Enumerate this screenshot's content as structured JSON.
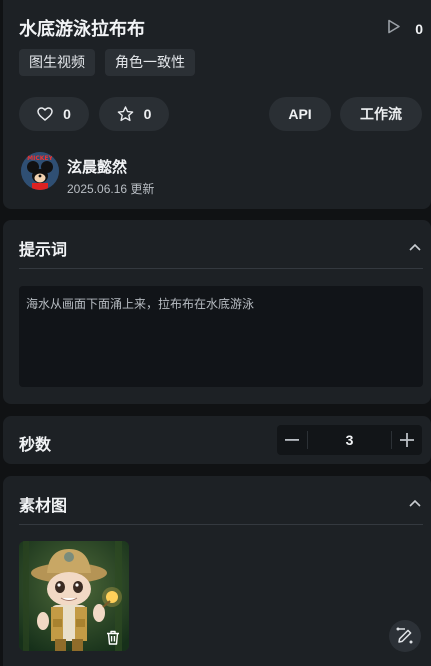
{
  "title": "水底游泳拉布布",
  "play_count": "0",
  "tags": [
    "图生视频",
    "角色一致性"
  ],
  "actions": {
    "like_count": "0",
    "favorite_count": "0",
    "api_label": "API",
    "workflow_label": "工作流"
  },
  "author": {
    "name": "泫晨懿然",
    "updated": "2025.06.16 更新",
    "avatar_text": "MICKEY"
  },
  "prompt_section": {
    "heading": "提示词",
    "text": "海水从画面下面涌上来，拉布布在水底游泳"
  },
  "seconds_section": {
    "heading": "秒数",
    "value": "3"
  },
  "material_section": {
    "heading": "素材图"
  },
  "icons": [
    "play-icon",
    "heart-icon",
    "star-icon",
    "chevron-up-icon",
    "minus-icon",
    "plus-icon",
    "trash-icon",
    "edit-icon"
  ],
  "colors": {
    "background": "#101214",
    "panel": "#1d2125",
    "pill": "#2a2f34",
    "text": "#f1f3f5"
  }
}
